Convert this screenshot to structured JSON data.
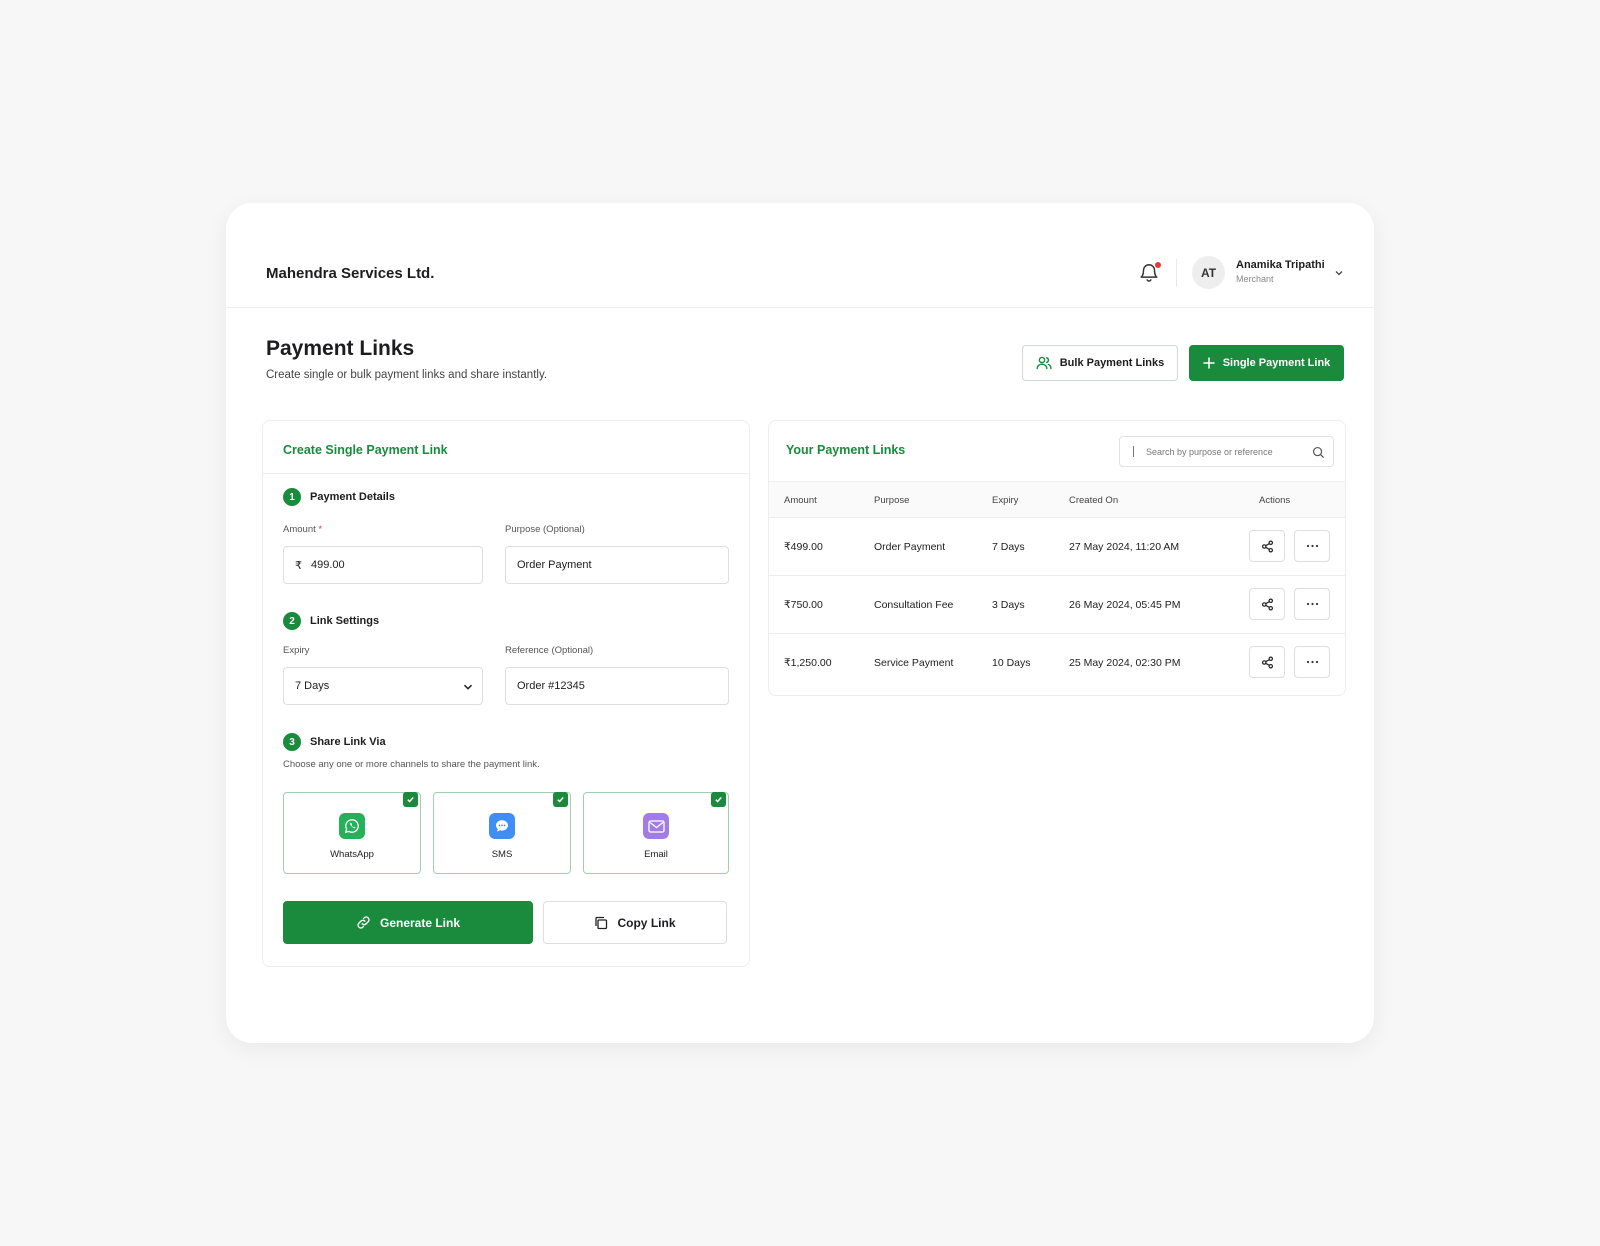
{
  "header": {
    "company": "Mahendra Services Ltd.",
    "user": {
      "initials": "AT",
      "name": "Anamika Tripathi",
      "role": "Merchant"
    }
  },
  "page": {
    "title": "Payment Links",
    "subtitle": "Create single or bulk payment links and share instantly.",
    "bulk_button": "Bulk Payment Links",
    "single_button": "Single Payment Link"
  },
  "create": {
    "title": "Create Single Payment Link",
    "step1": {
      "num": "1",
      "title": "Payment Details"
    },
    "amount": {
      "label": "Amount",
      "required": "*",
      "currency": "₹",
      "value": "499.00"
    },
    "purpose": {
      "label": "Purpose (Optional)",
      "value": "Order Payment"
    },
    "step2": {
      "num": "2",
      "title": "Link Settings"
    },
    "expiry": {
      "label": "Expiry",
      "value": "7 Days"
    },
    "reference": {
      "label": "Reference (Optional)",
      "value": "Order #12345"
    },
    "step3": {
      "num": "3",
      "title": "Share Link Via",
      "note": "Choose any one or more channels to share the payment link."
    },
    "channels": [
      {
        "label": "WhatsApp",
        "icon": "whatsapp-icon",
        "color": "#25b15a",
        "checked": true
      },
      {
        "label": "SMS",
        "icon": "sms-icon",
        "color": "#3f8ef5",
        "checked": true
      },
      {
        "label": "Email",
        "icon": "email-icon",
        "color": "#a27ce6",
        "checked": true
      }
    ],
    "generate_button": "Generate Link",
    "copy_button": "Copy Link"
  },
  "links": {
    "title": "Your Payment Links",
    "search_placeholder": "Search by purpose or reference",
    "columns": [
      "Amount",
      "Purpose",
      "Expiry",
      "Created On",
      "Actions"
    ],
    "rows": [
      {
        "amount": "₹499.00",
        "purpose": "Order Payment",
        "expiry": "7 Days",
        "created": "27 May 2024, 11:20 AM"
      },
      {
        "amount": "₹750.00",
        "purpose": "Consultation Fee",
        "expiry": "3 Days",
        "created": "26 May 2024, 05:45 PM"
      },
      {
        "amount": "₹1,250.00",
        "purpose": "Service Payment",
        "expiry": "10 Days",
        "created": "25 May 2024, 02:30 PM"
      }
    ]
  },
  "colors": {
    "accent": "#1a8a3c",
    "notification": "#e53935"
  }
}
